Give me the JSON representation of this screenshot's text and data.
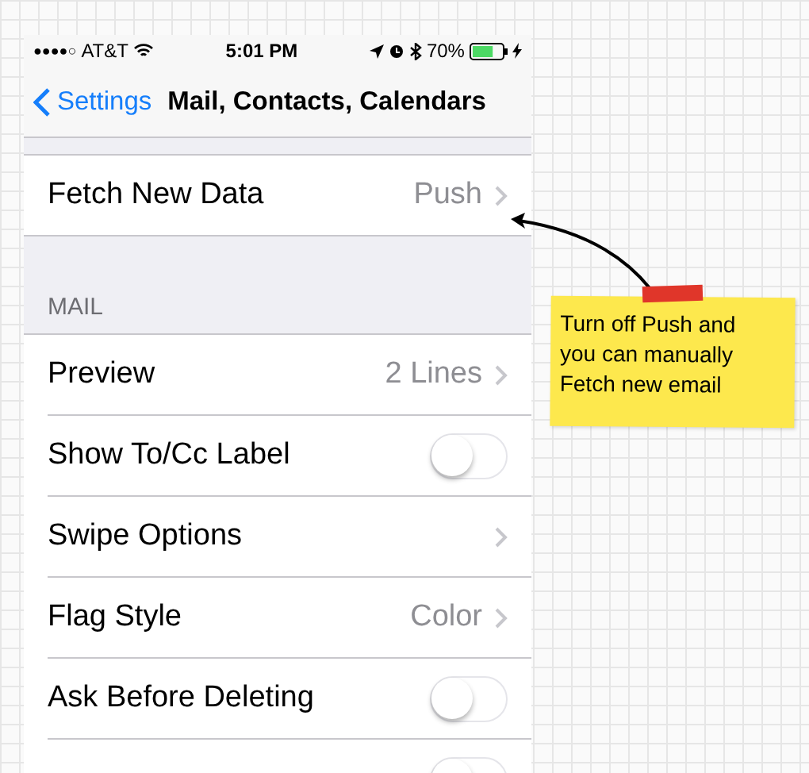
{
  "status_bar": {
    "signal_dots": "●●●●○",
    "carrier": "AT&T",
    "time": "5:01 PM",
    "battery_percent": "70%"
  },
  "nav_bar": {
    "back_label": "Settings",
    "title": "Mail, Contacts, Calendars"
  },
  "top_rows": [
    {
      "kind": "disclosure",
      "label": "Fetch New Data",
      "value": "Push"
    }
  ],
  "sections": [
    {
      "header": "MAIL",
      "rows": [
        {
          "kind": "disclosure",
          "label": "Preview",
          "value": "2 Lines"
        },
        {
          "kind": "toggle",
          "label": "Show To/Cc Label",
          "on": false
        },
        {
          "kind": "disclosure",
          "label": "Swipe Options"
        },
        {
          "kind": "disclosure",
          "label": "Flag Style",
          "value": "Color"
        },
        {
          "kind": "toggle",
          "label": "Ask Before Deleting",
          "on": false
        },
        {
          "kind": "toggle",
          "on": false
        }
      ]
    }
  ],
  "sticky_note": {
    "text": "Turn off Push and you can manually Fetch new email"
  }
}
